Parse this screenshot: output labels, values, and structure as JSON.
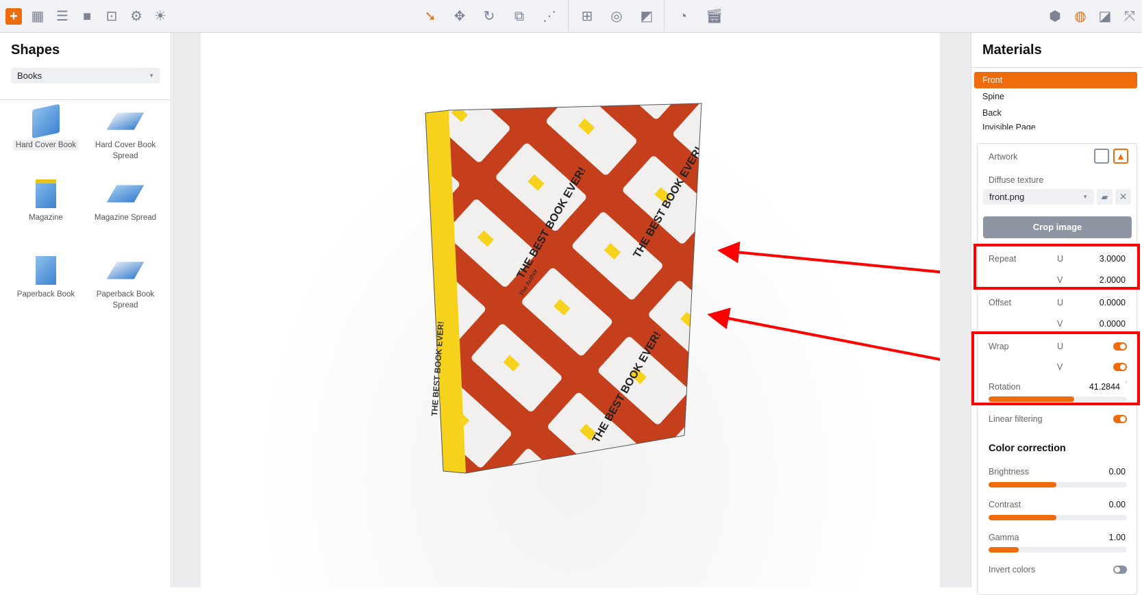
{
  "toolbar": {
    "left_icons": [
      "add-icon",
      "grid-icon",
      "list-icon",
      "camera-icon",
      "focus-icon",
      "gear-icon",
      "light-icon"
    ],
    "center_icons": [
      "select-arrow-icon",
      "move-icon",
      "rotate-icon",
      "scale-icon",
      "axes-icon",
      "floor-icon",
      "zoom-object-icon",
      "shading-icon",
      "timeline-icon",
      "clapper-icon"
    ],
    "right_icons": [
      "cube-icon",
      "material-icon",
      "layout-icon",
      "fullscreen-icon"
    ],
    "accent": "#ee6c0c"
  },
  "shapes": {
    "title": "Shapes",
    "category": "Books",
    "items": [
      {
        "label": "Hard Cover Book"
      },
      {
        "label": "Hard Cover Book Spread"
      },
      {
        "label": "Magazine"
      },
      {
        "label": "Magazine Spread"
      },
      {
        "label": "Paperback Book"
      },
      {
        "label": "Paperback Book Spread"
      }
    ]
  },
  "viewport": {
    "book_text": "THE BEST BOOK EVER!",
    "author": "The Author"
  },
  "materials": {
    "title": "Materials",
    "list": [
      "Front",
      "Spine",
      "Back",
      "Invisible Page"
    ],
    "selected": "Front",
    "artwork_label": "Artwork",
    "diffuse_label": "Diffuse texture",
    "diffuse_file": "front.png",
    "crop_label": "Crop image",
    "repeat_label": "Repeat",
    "repeat_u": "3.0000",
    "repeat_v": "2.0000",
    "offset_label": "Offset",
    "offset_u": "0.0000",
    "offset_v": "0.0000",
    "u": "U",
    "v": "V",
    "wrap_label": "Wrap",
    "wrap_u": true,
    "wrap_v": true,
    "rotation_label": "Rotation",
    "rotation": "41.2844",
    "deg": "°",
    "rotation_fraction": 0.62,
    "linear_label": "Linear filtering",
    "linear": true,
    "color_title": "Color correction",
    "brightness_label": "Brightness",
    "brightness": "0.00",
    "brightness_fraction": 0.49,
    "contrast_label": "Contrast",
    "contrast": "0.00",
    "contrast_fraction": 0.49,
    "gamma_label": "Gamma",
    "gamma": "1.00",
    "gamma_fraction": 0.22,
    "invert_label": "Invert colors",
    "invert": false
  }
}
